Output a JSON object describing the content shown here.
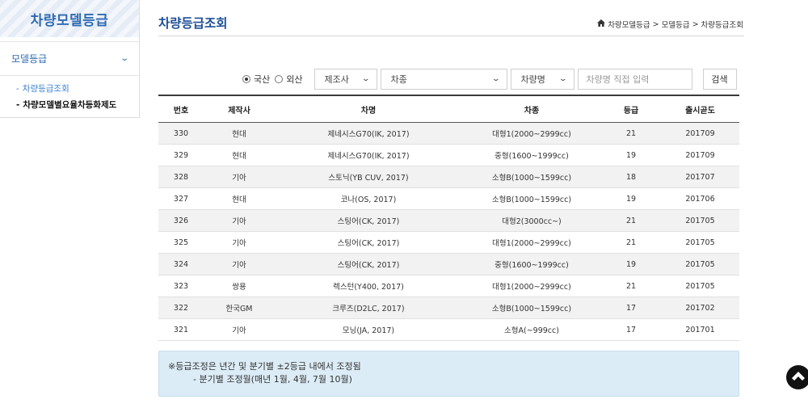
{
  "sidebar": {
    "title": "차량모델등급",
    "menu_label": "모델등급",
    "items": [
      {
        "label": "차량등급조회"
      },
      {
        "label": "차량모델별요율차등화제도"
      }
    ]
  },
  "header": {
    "title": "차량등급조회",
    "breadcrumb": [
      "차량모델등급",
      ">",
      "모델등급",
      ">",
      "차량등급조회"
    ]
  },
  "search": {
    "radio_domestic": "국산",
    "radio_import": "외산",
    "maker_select": "제조사",
    "type_select": "차종",
    "name_select": "차량명",
    "name_placeholder": "차량명 직접 입력",
    "search_button": "검색"
  },
  "table": {
    "headers": [
      "번호",
      "제작사",
      "차명",
      "차종",
      "등급",
      "출시곧도"
    ],
    "rows": [
      [
        "330",
        "현대",
        "제네시스G70(IK, 2017)",
        "대형1(2000~2999cc)",
        "21",
        "201709"
      ],
      [
        "329",
        "현대",
        "제네시스G70(IK, 2017)",
        "중형(1600~1999cc)",
        "19",
        "201709"
      ],
      [
        "328",
        "기아",
        "스토닉(YB CUV, 2017)",
        "소형B(1000~1599cc)",
        "18",
        "201707"
      ],
      [
        "327",
        "현대",
        "코나(OS, 2017)",
        "소형B(1000~1599cc)",
        "19",
        "201706"
      ],
      [
        "326",
        "기아",
        "스팅어(CK, 2017)",
        "대형2(3000cc~)",
        "21",
        "201705"
      ],
      [
        "325",
        "기아",
        "스팅어(CK, 2017)",
        "대형1(2000~2999cc)",
        "21",
        "201705"
      ],
      [
        "324",
        "기아",
        "스팅어(CK, 2017)",
        "중형(1600~1999cc)",
        "19",
        "201705"
      ],
      [
        "323",
        "쌍용",
        "렉스턴(Y400, 2017)",
        "대형1(2000~2999cc)",
        "21",
        "201705"
      ],
      [
        "322",
        "한국GM",
        "크루즈(D2LC, 2017)",
        "소형B(1000~1599cc)",
        "17",
        "201702"
      ],
      [
        "321",
        "기아",
        "모닝(JA, 2017)",
        "소형A(~999cc)",
        "17",
        "201701"
      ]
    ]
  },
  "notice": {
    "line1": "※등급조정은 년간 및 분기별 ±2등급 내에서 조정됨",
    "line2": "- 분기별 조정월(매년 1월, 4월, 7월 10월)"
  },
  "colors": {
    "brand_blue": "#2f6bb3",
    "title_blue": "#1e4f96",
    "notice_bg": "#dcecf6",
    "row_shade": "#f2f2f2"
  },
  "icons": {
    "home": "home-icon",
    "chevron": "chevron-down-icon",
    "scroll_top": "chevron-up-icon"
  }
}
